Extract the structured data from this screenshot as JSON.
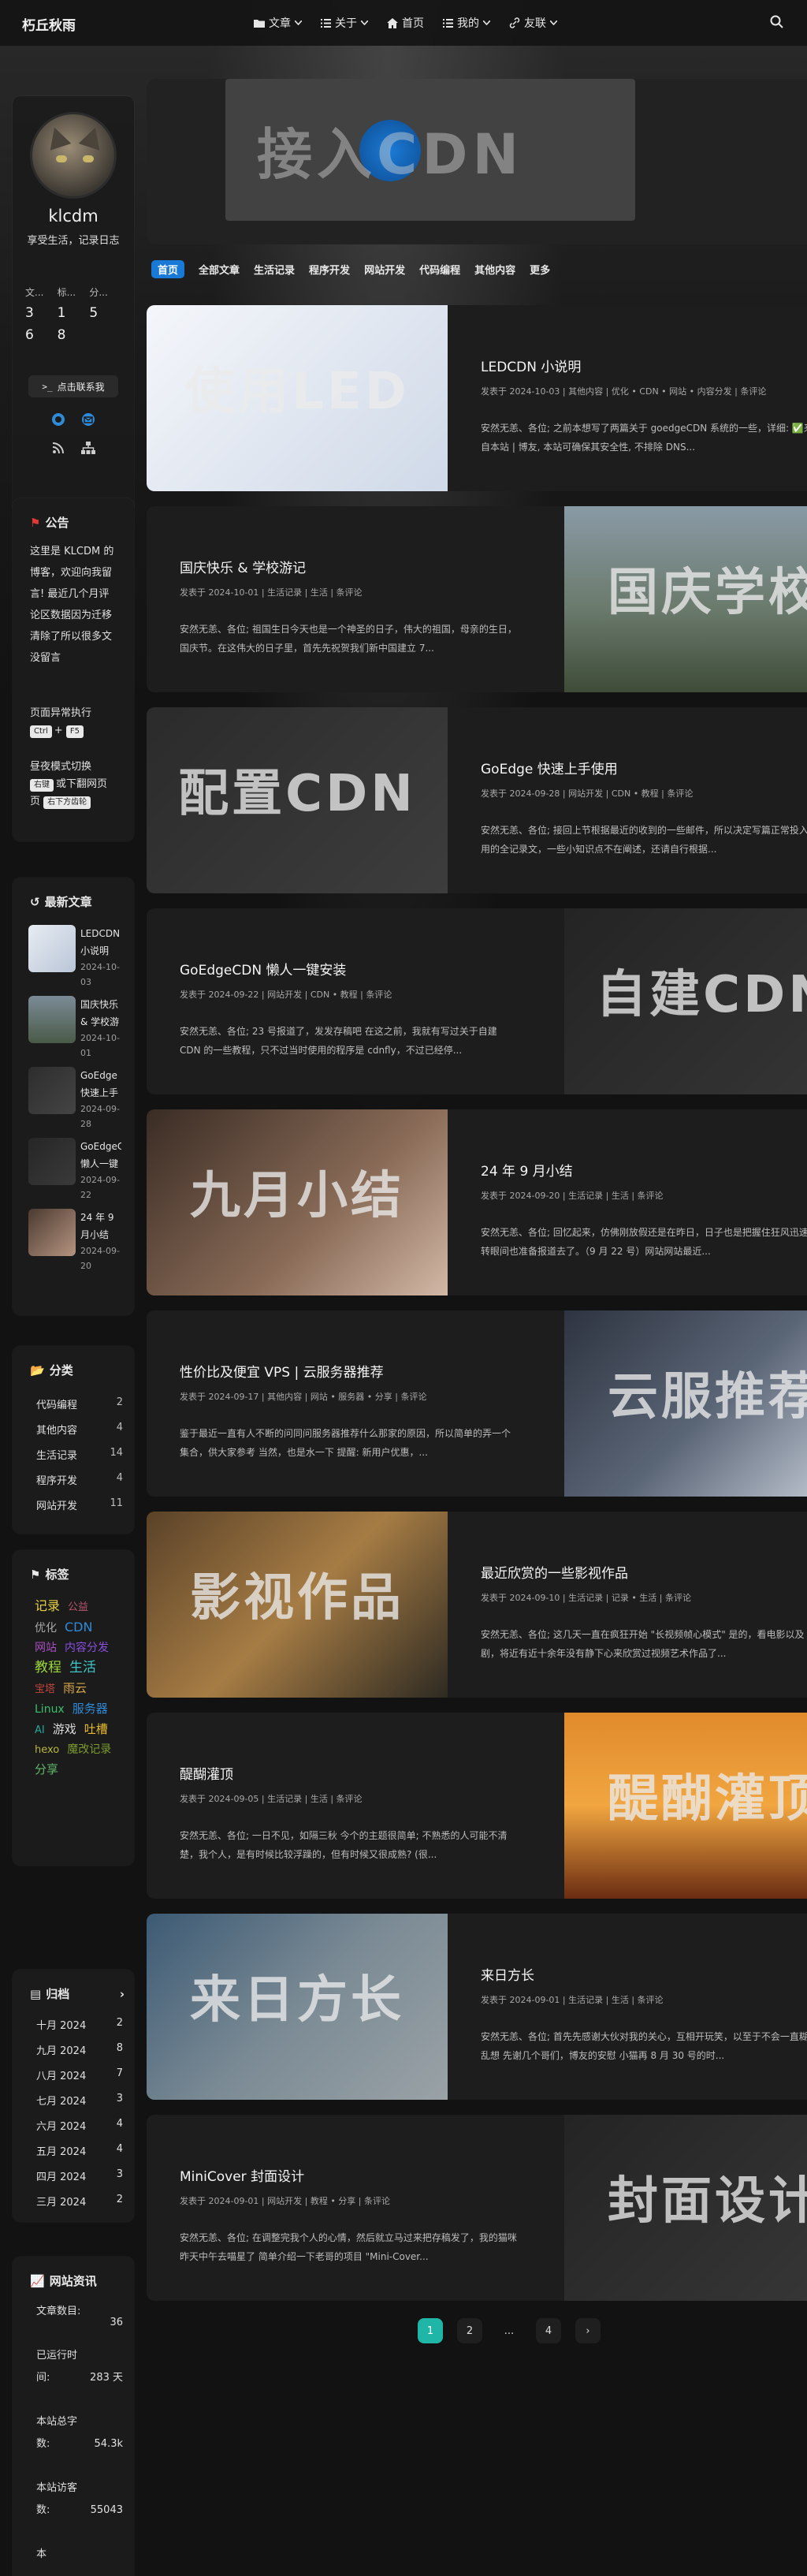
{
  "nav": {
    "brand": "朽丘秋雨",
    "menu": [
      {
        "label": "文章",
        "icon": "folder-icon"
      },
      {
        "label": "关于",
        "icon": "list-icon"
      },
      {
        "label": "首页",
        "icon": "home-icon"
      },
      {
        "label": "我的",
        "icon": "list-icon"
      },
      {
        "label": "友联",
        "icon": "link-icon"
      }
    ]
  },
  "profile": {
    "name": "klcdm",
    "desc": "享受生活，记录日志",
    "stats": [
      {
        "label": "文...",
        "value": "3"
      },
      {
        "label": "标...",
        "value": "1"
      },
      {
        "label": "分...",
        "value": "5"
      },
      {
        "label": "",
        "value": "6"
      },
      {
        "label": "",
        "value": "8"
      },
      {
        "label": "",
        "value": ""
      }
    ],
    "contact_label": "点击联系我"
  },
  "announcement": {
    "title": "公告",
    "text": "这里是 KLCDM 的博客，欢迎向我留言! 最近几个月评论区数据因为迁移清除了所以很多文没留言",
    "hint1": "页面异常执行",
    "keys": [
      "Ctrl",
      "F5"
    ],
    "hint2a": "昼夜模式切换",
    "key_right": "右键",
    "hint2b": "或下翻网页",
    "key_bottom": "右下方齿轮"
  },
  "recent": {
    "title": "最新文章",
    "items": [
      {
        "title": "LEDCDN 小说明",
        "date": "2024-10-03"
      },
      {
        "title": "国庆快乐 & 学校游记",
        "date": "2024-10-01"
      },
      {
        "title": "GoEdge 快速上手使用",
        "date": "2024-09-28"
      },
      {
        "title": "GoEdgeCDN 懒人一键安装",
        "date": "2024-09-22"
      },
      {
        "title": "24 年 9 月小结",
        "date": "2024-09-20"
      }
    ]
  },
  "categories": {
    "title": "分类",
    "items": [
      {
        "name": "代码编程",
        "count": "2"
      },
      {
        "name": "其他内容",
        "count": "4"
      },
      {
        "name": "生活记录",
        "count": "14"
      },
      {
        "name": "程序开发",
        "count": "4"
      },
      {
        "name": "网站开发",
        "count": "11"
      }
    ]
  },
  "tags": {
    "title": "标签",
    "items": [
      {
        "name": "记录",
        "color": "#e6d23c",
        "size": "16px"
      },
      {
        "name": "公益",
        "color": "#b5566d",
        "size": "13px"
      },
      {
        "name": "优化",
        "color": "#a8a8a8",
        "size": "14px"
      },
      {
        "name": "CDN",
        "color": "#2f8ad8",
        "size": "16px"
      },
      {
        "name": "网站",
        "color": "#a84fc3",
        "size": "14px"
      },
      {
        "name": "内容分发",
        "color": "#8b4de0",
        "size": "14px"
      },
      {
        "name": "教程",
        "color": "#9bd63a",
        "size": "17px"
      },
      {
        "name": "生活",
        "color": "#3ec6c6",
        "size": "17px"
      },
      {
        "name": "宝塔",
        "color": "#c0463c",
        "size": "13px"
      },
      {
        "name": "雨云",
        "color": "#d6a64a",
        "size": "15px"
      },
      {
        "name": "Linux",
        "color": "#36c26b",
        "size": "14px"
      },
      {
        "name": "服务器",
        "color": "#2f8ad8",
        "size": "15px"
      },
      {
        "name": "AI",
        "color": "#26a69a",
        "size": "13px"
      },
      {
        "name": "游戏",
        "color": "#dddddd",
        "size": "15px"
      },
      {
        "name": "吐槽",
        "color": "#e6b92e",
        "size": "15px"
      },
      {
        "name": "hexo",
        "color": "#b8b43a",
        "size": "13px"
      },
      {
        "name": "魔改记录",
        "color": "#7a9a2e",
        "size": "14px"
      },
      {
        "name": "分享",
        "color": "#5fb86a",
        "size": "15px"
      }
    ]
  },
  "archives": {
    "title": "归档",
    "items": [
      {
        "month": "十月 2024",
        "count": "2"
      },
      {
        "month": "九月 2024",
        "count": "8"
      },
      {
        "month": "八月 2024",
        "count": "7"
      },
      {
        "month": "七月 2024",
        "count": "3"
      },
      {
        "month": "六月 2024",
        "count": "4"
      },
      {
        "month": "五月 2024",
        "count": "4"
      },
      {
        "month": "四月 2024",
        "count": "3"
      },
      {
        "month": "三月 2024",
        "count": "2"
      }
    ]
  },
  "siteinfo": {
    "title": "网站资讯",
    "rows": [
      {
        "label": "文章数目:",
        "value": "36"
      },
      {
        "label": "已运行时间:",
        "value": "283 天"
      },
      {
        "label": "本站总字数:",
        "value": "54.3k"
      },
      {
        "label": "本站访客数:",
        "value": "55043"
      },
      {
        "label": "本",
        "value": ""
      }
    ]
  },
  "hero": {
    "overlay": "接入CDN"
  },
  "tabs": [
    "首页",
    "全部文章",
    "生活记录",
    "程序开发",
    "网站开发",
    "代码编程",
    "其他内容",
    "更多"
  ],
  "posts": [
    {
      "title": "LEDCDN 小说明",
      "overlay": "使用LED",
      "meta": "发表于 2024-10-03 | 其他内容 | 优化 • CDN • 网站 • 内容分发 | 条评论",
      "excerpt": "安然无恙、各位;  之前本想写了两篇关于 goedgeCDN 系统的一些，详细:  ✅来自本站 | 博友, 本站可确保其安全性, 不排除 DNS..."
    },
    {
      "title": "国庆快乐 & 学校游记",
      "overlay": "国庆学校",
      "meta": "发表于 2024-10-01 | 生活记录 | 生活 | 条评论",
      "excerpt": "安然无恙、各位;  祖国生日今天也是一个神圣的日子，伟大的祖国，母亲的生日，国庆节。在这伟大的日子里，首先先祝贺我们新中国建立 7..."
    },
    {
      "title": "GoEdge 快速上手使用",
      "overlay": "配置CDN",
      "meta": "发表于 2024-09-28 | 网站开发 | CDN • 教程 | 条评论",
      "excerpt": "安然无恙、各位;  接回上节根据最近的收到的一些邮件，所以决定写篇正常投入使用的全记录文，一些小知识点不在阐述，还请自行根据..."
    },
    {
      "title": "GoEdgeCDN 懒人一键安装",
      "overlay": "自建CDN",
      "meta": "发表于 2024-09-22 | 网站开发 | CDN • 教程 | 条评论",
      "excerpt": "安然无恙、各位;  23 号报道了，发发存稿吧 在这之前，我就有写过关于自建 CDN 的一些教程，只不过当时使用的程序是 cdnfly，不过已经停..."
    },
    {
      "title": "24 年 9 月小结",
      "overlay": "九月小结",
      "meta": "发表于 2024-09-20 | 生活记录 | 生活 | 条评论",
      "excerpt": "安然无恙、各位;  回忆起来，仿佛刚放假还是在昨日，日子也是把握住狂风迅速，转眼间也准备报道去了。（9 月 22 号）网站网站最近..."
    },
    {
      "title": "性价比及便宜 VPS | 云服务器推荐",
      "overlay": "云服推荐",
      "meta": "发表于 2024-09-17 | 其他内容 | 网站 • 服务器 • 分享 | 条评论",
      "excerpt": "鉴于最近一直有人不断的问同问服务器推荐什么那家的原因，所以简单的弄一个集合，供大家参考 当然，也是水一下 提醒:  新用户优惠，..."
    },
    {
      "title": "最近欣赏的一些影视作品",
      "overlay": "影视作品",
      "meta": "发表于 2024-09-10 | 生活记录 | 记录 • 生活 | 条评论",
      "excerpt": "安然无恙、各位;  这几天一直在疯狂开始 \"长视频帧心模式\" 是的，看电影以及剧，将近有近十余年没有静下心来欣赏过视频艺术作品了..."
    },
    {
      "title": "醍醐灌顶",
      "overlay": "醍醐灌顶",
      "meta": "发表于 2024-09-05 | 生活记录 | 生活 | 条评论",
      "excerpt": "安然无恙、各位;  一日不见，如隔三秋 今个的主题很简单; 不熟悉的人可能不清楚，我个人，是有时候比较浮躁的，但有时候又很成熟? (很..."
    },
    {
      "title": "来日方长",
      "overlay": "来日方长",
      "meta": "发表于 2024-09-01 | 生活记录 | 生活 | 条评论",
      "excerpt": "安然无恙、各位;  首先先感谢大伙对我的关心，互相开玩笑，以至于不会一直糊涂乱想 先谢几个哥们，博友的安慰 小猫再 8 月 30 号的时..."
    },
    {
      "title": "MiniCover 封面设计",
      "overlay": "封面设计",
      "meta": "发表于 2024-09-01 | 网站开发 | 教程 • 分享 | 条评论",
      "excerpt": "安然无恙、各位;  在调整完我个人的心情，然后就立马过来把存稿发了，我的猫咪昨天中午去喵星了 简单介绍一下老哥的项目 \"Mini-Cover..."
    }
  ],
  "pager": {
    "pages": [
      "1",
      "2",
      "...",
      "4"
    ],
    "current": "1"
  }
}
